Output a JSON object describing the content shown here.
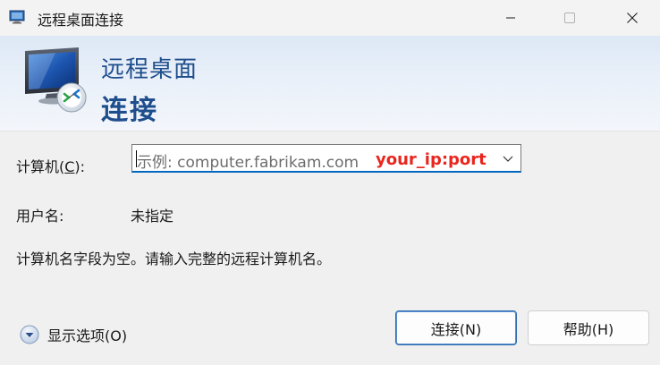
{
  "window": {
    "title": "远程桌面连接",
    "controls": [
      "minimize-icon",
      "maximize-icon",
      "close-icon"
    ]
  },
  "banner": {
    "line1": "远程桌面",
    "line2": "连接",
    "icon": "remote-desktop-monitor-icon",
    "colors": {
      "heading": "#1f4e8c",
      "gradient_top": "#dde8f6"
    }
  },
  "form": {
    "computer_label_prefix": "计算机(",
    "computer_label_hotkey": "C",
    "computer_label_suffix": "):",
    "computer_placeholder": "示例: computer.fabrikam.com",
    "computer_value": "",
    "annotation": "your_ip:port",
    "username_label": "用户名:",
    "username_value": "未指定",
    "warning": "计算机名字段为空。请输入完整的远程计算机名。"
  },
  "options": {
    "label": "显示选项(O)",
    "icon": "chevron-down-circle-icon"
  },
  "buttons": {
    "connect": "连接(N)",
    "help": "帮助(H)"
  },
  "colors": {
    "accent": "#0067c0",
    "annotation": "#e8261e"
  }
}
